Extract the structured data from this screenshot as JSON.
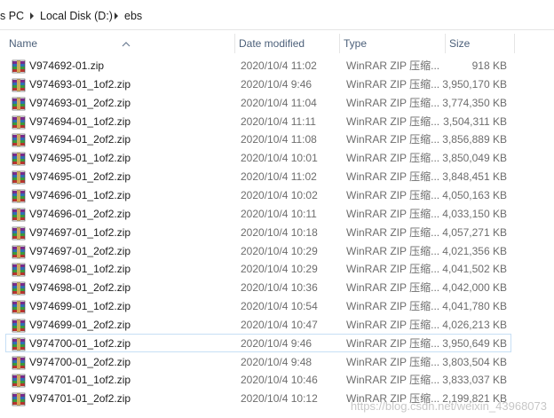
{
  "breadcrumb": {
    "items": [
      "s PC",
      "Local Disk (D:)",
      "ebs"
    ]
  },
  "columns": {
    "name": "Name",
    "date": "Date modified",
    "type": "Type",
    "size": "Size"
  },
  "files": [
    {
      "name": "V974692-01.zip",
      "date": "2020/10/4 11:02",
      "type": "WinRAR ZIP 压缩...",
      "size": "918 KB"
    },
    {
      "name": "V974693-01_1of2.zip",
      "date": "2020/10/4 9:46",
      "type": "WinRAR ZIP 压缩...",
      "size": "3,950,170 KB"
    },
    {
      "name": "V974693-01_2of2.zip",
      "date": "2020/10/4 11:04",
      "type": "WinRAR ZIP 压缩...",
      "size": "3,774,350 KB"
    },
    {
      "name": "V974694-01_1of2.zip",
      "date": "2020/10/4 11:11",
      "type": "WinRAR ZIP 压缩...",
      "size": "3,504,311 KB"
    },
    {
      "name": "V974694-01_2of2.zip",
      "date": "2020/10/4 11:08",
      "type": "WinRAR ZIP 压缩...",
      "size": "3,856,889 KB"
    },
    {
      "name": "V974695-01_1of2.zip",
      "date": "2020/10/4 10:01",
      "type": "WinRAR ZIP 压缩...",
      "size": "3,850,049 KB"
    },
    {
      "name": "V974695-01_2of2.zip",
      "date": "2020/10/4 11:02",
      "type": "WinRAR ZIP 压缩...",
      "size": "3,848,451 KB"
    },
    {
      "name": "V974696-01_1of2.zip",
      "date": "2020/10/4 10:02",
      "type": "WinRAR ZIP 压缩...",
      "size": "4,050,163 KB"
    },
    {
      "name": "V974696-01_2of2.zip",
      "date": "2020/10/4 10:11",
      "type": "WinRAR ZIP 压缩...",
      "size": "4,033,150 KB"
    },
    {
      "name": "V974697-01_1of2.zip",
      "date": "2020/10/4 10:18",
      "type": "WinRAR ZIP 压缩...",
      "size": "4,057,271 KB"
    },
    {
      "name": "V974697-01_2of2.zip",
      "date": "2020/10/4 10:29",
      "type": "WinRAR ZIP 压缩...",
      "size": "4,021,356 KB"
    },
    {
      "name": "V974698-01_1of2.zip",
      "date": "2020/10/4 10:29",
      "type": "WinRAR ZIP 压缩...",
      "size": "4,041,502 KB"
    },
    {
      "name": "V974698-01_2of2.zip",
      "date": "2020/10/4 10:36",
      "type": "WinRAR ZIP 压缩...",
      "size": "4,042,000 KB"
    },
    {
      "name": "V974699-01_1of2.zip",
      "date": "2020/10/4 10:54",
      "type": "WinRAR ZIP 压缩...",
      "size": "4,041,780 KB"
    },
    {
      "name": "V974699-01_2of2.zip",
      "date": "2020/10/4 10:47",
      "type": "WinRAR ZIP 压缩...",
      "size": "4,026,213 KB"
    },
    {
      "name": "V974700-01_1of2.zip",
      "date": "2020/10/4 9:46",
      "type": "WinRAR ZIP 压缩...",
      "size": "3,950,649 KB",
      "selected": true
    },
    {
      "name": "V974700-01_2of2.zip",
      "date": "2020/10/4 9:48",
      "type": "WinRAR ZIP 压缩...",
      "size": "3,803,504 KB"
    },
    {
      "name": "V974701-01_1of2.zip",
      "date": "2020/10/4 10:46",
      "type": "WinRAR ZIP 压缩...",
      "size": "3,833,037 KB"
    },
    {
      "name": "V974701-01_2of2.zip",
      "date": "2020/10/4 10:12",
      "type": "WinRAR ZIP 压缩...",
      "size": "2,199,821 KB"
    }
  ],
  "file_icon": "winrar-archive-icon",
  "watermark": "https://blog.csdn.net/weixin_43968073",
  "colors": {
    "header_text": "#4c607a",
    "selection_border": "#c7dff5"
  }
}
